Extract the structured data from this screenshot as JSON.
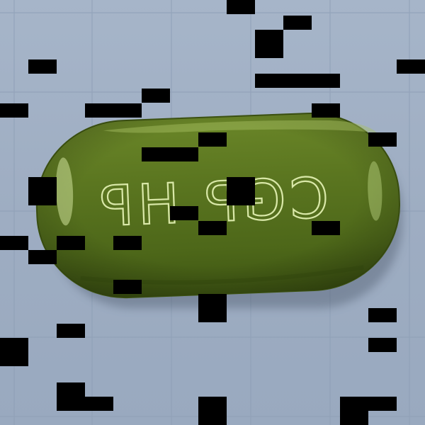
{
  "photo": {
    "subject": "pill",
    "background_color": "#a1b0c5",
    "grid_color": "#8e9fb6",
    "pill_color": "#556f1c",
    "imprint_color": "#d9e8a8",
    "imprint_text": "CGP HP",
    "redaction_color": "#000000"
  }
}
